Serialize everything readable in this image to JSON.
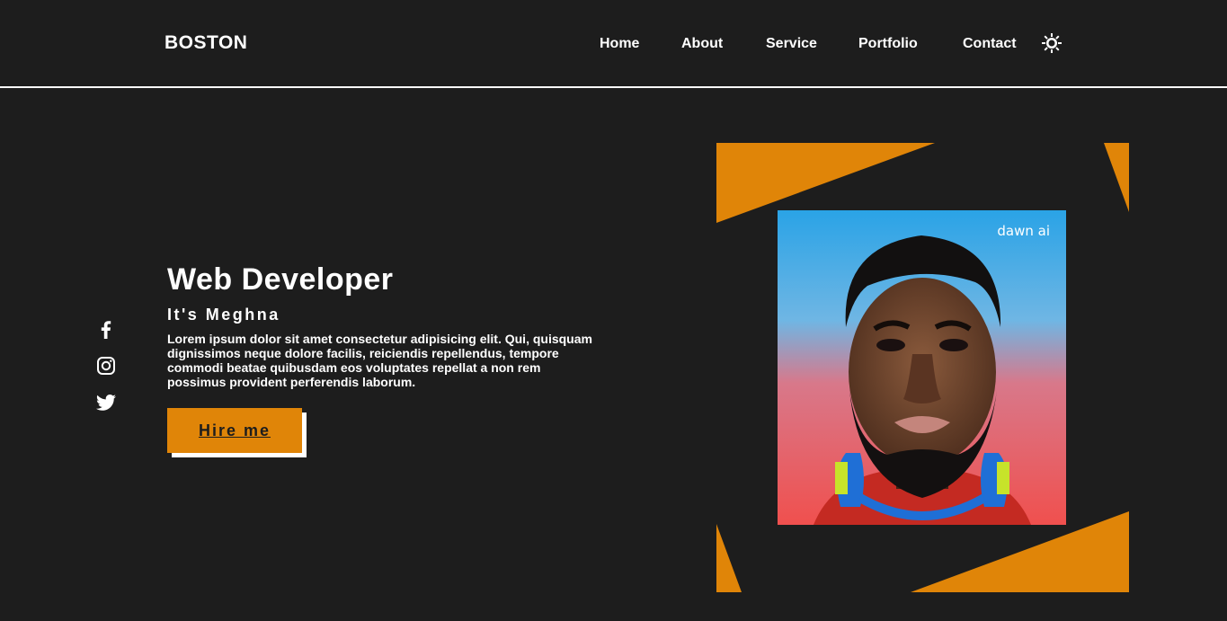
{
  "header": {
    "logo": "BOSTON",
    "nav": [
      {
        "label": "Home"
      },
      {
        "label": "About"
      },
      {
        "label": "Service"
      },
      {
        "label": "Portfolio"
      },
      {
        "label": "Contact"
      }
    ],
    "theme_icon": "sun-icon"
  },
  "socials": [
    {
      "icon": "facebook-icon"
    },
    {
      "icon": "instagram-icon"
    },
    {
      "icon": "twitter-icon"
    }
  ],
  "hero": {
    "title": "Web Developer",
    "subtitle": "It's Meghna",
    "description": "Lorem ipsum dolor sit amet consectetur adipisicing elit. Qui, quisquam dignissimos neque dolore facilis, reiciendis repellendus, tempore commodi beatae quibusdam eos voluptates repellat a non rem possimus provident perferendis laborum.",
    "cta_label": "Hire me"
  },
  "portrait": {
    "watermark": "dawn ai"
  },
  "colors": {
    "background": "#1d1d1d",
    "accent": "#e08508",
    "text": "#ffffff"
  }
}
